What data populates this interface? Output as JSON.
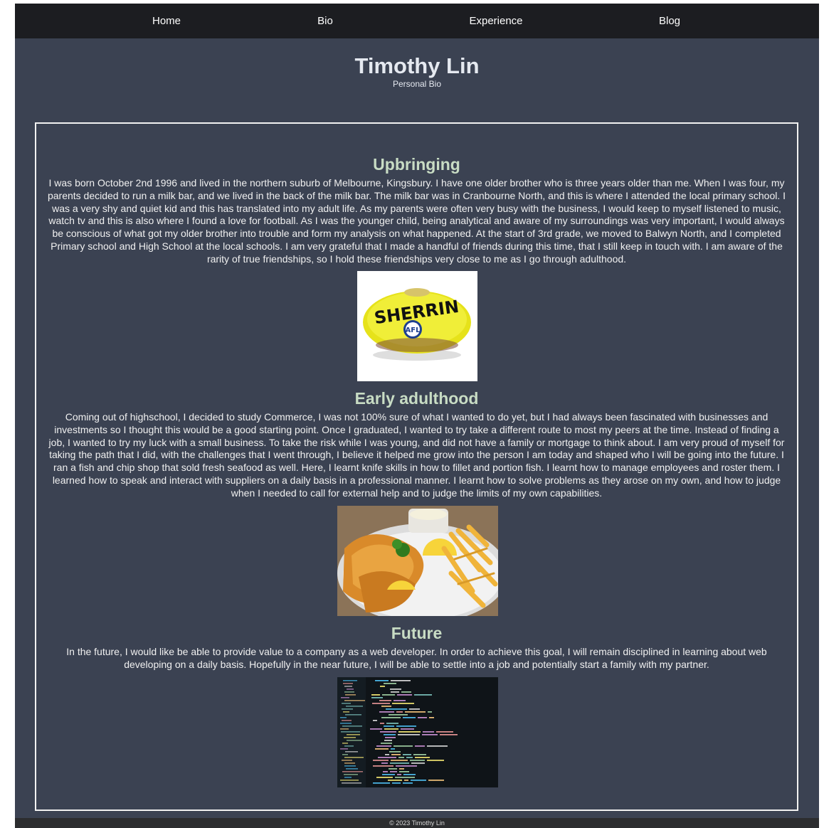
{
  "nav": {
    "items": [
      {
        "label": "Home"
      },
      {
        "label": "Bio"
      },
      {
        "label": "Experience"
      },
      {
        "label": "Blog"
      }
    ]
  },
  "header": {
    "title": "Timothy Lin",
    "subtitle": "Personal Bio"
  },
  "sections": [
    {
      "heading": "Upbringing",
      "text": "I was born October 2nd 1996 and lived in the northern suburb of Melbourne, Kingsbury. I have one older brother who is three years older than me. When I was four, my parents decided to run a milk bar, and we lived in the back of the milk bar. The milk bar was in Cranbourne North, and this is where I attended the local primary school. I was a very shy and quiet kid and this has translated into my adult life. As my parents were often very busy with the business, I would keep to myself listened to music, watch tv and this is also where I found a love for football. As I was the younger child, being analytical and aware of my surroundings was very important, I would always be conscious of what got my older brother into trouble and form my analysis on what happened. At the start of 3rd grade, we moved to Balwyn North, and I completed Primary school and High School at the local schools. I am very grateful that I made a handful of friends during this time, that I still keep in touch with. I am aware of the rarity of true friendships, so I hold these friendships very close to me as I go through adulthood.",
      "image": {
        "brand": "SHERRIN",
        "badge": "AFL"
      }
    },
    {
      "heading": "Early adulthood",
      "text": "Coming out of highschool, I decided to study Commerce, I was not 100% sure of what I wanted to do yet, but I had always been fascinated with businesses and investments so I thought this would be a good starting point. Once I graduated, I wanted to try take a different route to most my peers at the time. Instead of finding a job, I wanted to try my luck with a small business. To take the risk while I was young, and did not have a family or mortgage to think about. I am very proud of myself for taking the path that I did, with the challenges that I went through, I believe it helped me grow into the person I am today and shaped who I will be going into the future. I ran a fish and chip shop that sold fresh seafood as well. Here, I learnt knife skills in how to fillet and portion fish. I learnt how to manage employees and roster them. I learned how to speak and interact with suppliers on a daily basis in a professional manner. I learnt how to solve problems as they arose on my own, and how to judge when I needed to call for external help and to judge the limits of my own capabilities."
    },
    {
      "heading": "Future",
      "text": "In the future, I would like be able to provide value to a company as a web developer. In order to achieve this goal, I will remain disciplined in learning about web developing on a daily basis. Hopefully in the near future, I will be able to settle into a job and potentially start a family with my partner."
    }
  ],
  "footer": {
    "text": "© 2023 Timothy Lin"
  },
  "colors": {
    "page_bg": "#3b4252",
    "nav_bg": "#1c1d21",
    "heading": "#c8dcc4",
    "footer_bg": "#2c2d2f"
  }
}
